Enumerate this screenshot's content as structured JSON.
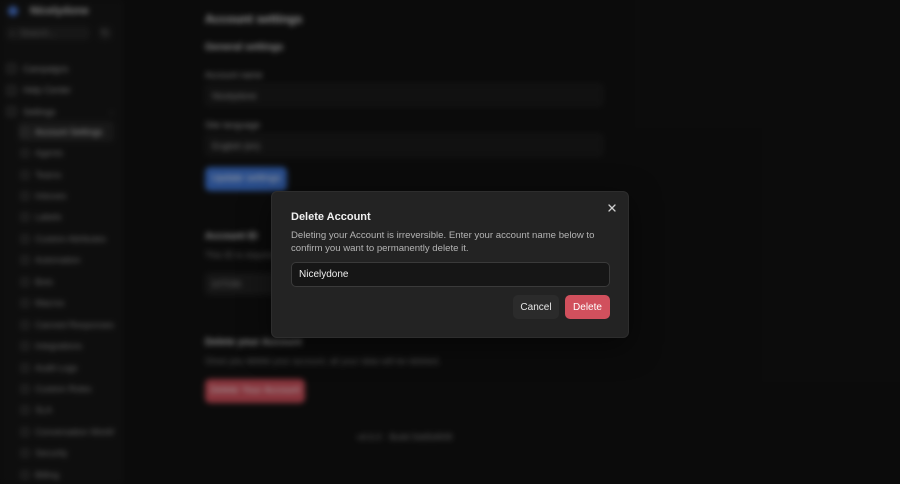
{
  "app": {
    "brand_name": "Nicelydone",
    "search_placeholder": "Search...",
    "nav_top": [
      {
        "label": "Campaigns"
      },
      {
        "label": "Help Center"
      },
      {
        "label": "Settings"
      }
    ],
    "settings_items": [
      {
        "label": "Account Settings"
      },
      {
        "label": "Agents"
      },
      {
        "label": "Teams"
      },
      {
        "label": "Inboxes"
      },
      {
        "label": "Labels"
      },
      {
        "label": "Custom Attributes"
      },
      {
        "label": "Automation"
      },
      {
        "label": "Bots"
      },
      {
        "label": "Macros"
      },
      {
        "label": "Canned Responses"
      },
      {
        "label": "Integrations"
      },
      {
        "label": "Audit Logs"
      },
      {
        "label": "Custom Roles"
      },
      {
        "label": "SLA"
      },
      {
        "label": "Conversation Workflows"
      },
      {
        "label": "Security"
      },
      {
        "label": "Billing"
      }
    ]
  },
  "page": {
    "title": "Account settings",
    "general_title": "General settings",
    "account_name_label": "Account name",
    "account_name_value": "Nicelydone",
    "site_language_label": "Site language",
    "site_language_value": "English (en)",
    "update_button": "Update settings",
    "account_id_title": "Account ID",
    "account_id_desc": "This ID is required if you are building an API based integration",
    "account_id_value": "107036",
    "delete_title": "Delete your Account",
    "delete_desc": "Once you delete your account, all your data will be deleted.",
    "delete_button": "Delete Your Account",
    "version": "v4.6.0  ·  Build 5dd5d908"
  },
  "modal": {
    "title": "Delete Account",
    "description": "Deleting your Account is irreversible. Enter your account name below to confirm you want to permanently delete it.",
    "input_value": "Nicelydone",
    "cancel_label": "Cancel",
    "delete_label": "Delete"
  },
  "colors": {
    "accent_blue": "#3f76d6",
    "danger_red": "#d1505d",
    "modal_bg": "#232323"
  }
}
